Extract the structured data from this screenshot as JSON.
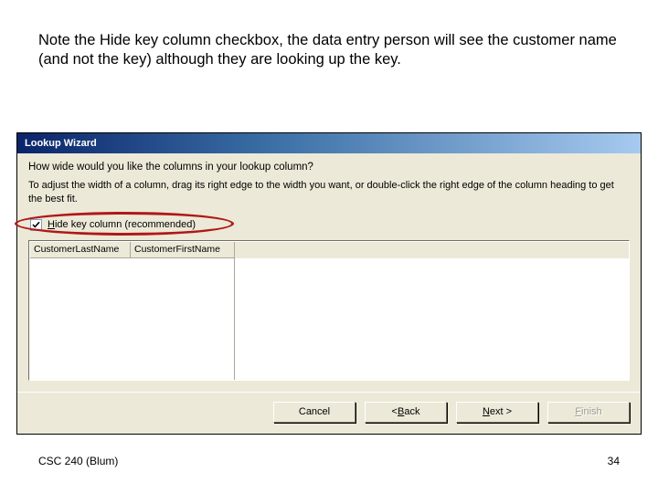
{
  "slide": {
    "caption": "Note the Hide key column checkbox, the data entry person will see the customer name (and not the key) although they are looking up the key.",
    "footer_left": "CSC 240 (Blum)",
    "footer_right": "34"
  },
  "dialog": {
    "title": "Lookup Wizard",
    "prompt": "How wide would you like the columns in your lookup column?",
    "instructions": "To adjust the width of a column, drag its right edge to the width you want, or double-click the right edge of the column heading to get the best fit.",
    "checkbox": {
      "checked": true,
      "mnemonic": "H",
      "label_rest": "ide key column (recommended)"
    },
    "columns": [
      "CustomerLastName",
      "CustomerFirstName"
    ],
    "buttons": {
      "cancel": "Cancel",
      "back_prefix": "< ",
      "back_mnemonic": "B",
      "back_rest": "ack",
      "next_mnemonic": "N",
      "next_rest": "ext >",
      "finish_mnemonic": "F",
      "finish_rest": "inish"
    }
  }
}
